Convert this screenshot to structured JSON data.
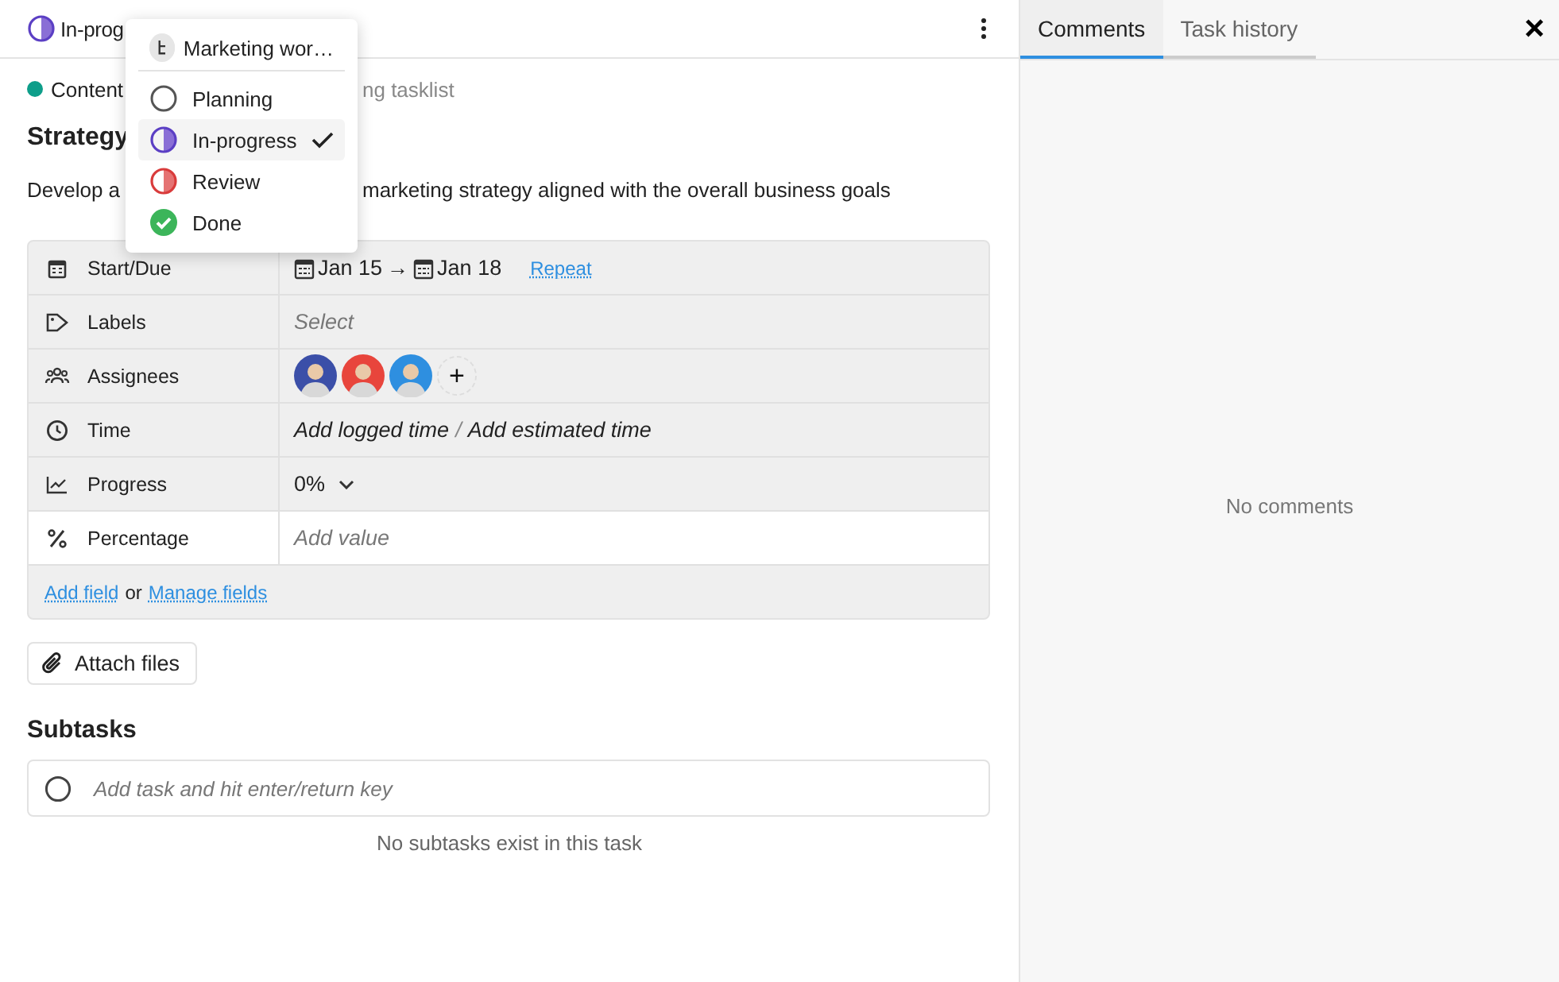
{
  "header": {
    "status": {
      "kind": "inprogress",
      "label": "In-prog"
    }
  },
  "breadcrumb": {
    "color": "#0e9e8a",
    "parts": [
      "Content",
      "ng tasklist"
    ]
  },
  "title": "Strategy",
  "description": [
    "Develop a",
    "marketing strategy aligned with the overall business goals"
  ],
  "status_menu": {
    "workflow": "Marketing wor…",
    "options": [
      {
        "kind": "planning",
        "label": "Planning",
        "selected": false
      },
      {
        "kind": "inprogress",
        "label": "In-progress",
        "selected": true
      },
      {
        "kind": "review",
        "label": "Review",
        "selected": false
      },
      {
        "kind": "done",
        "label": "Done",
        "selected": false
      }
    ]
  },
  "fields": [
    {
      "kind": "dates",
      "highlighted": false,
      "label": "Start/Due",
      "start": "Jan 15",
      "arrow": "→",
      "due": "Jan 18",
      "link": "Repeat"
    },
    {
      "kind": "placeholder",
      "highlighted": false,
      "label": "Labels",
      "placeholder": "Select"
    },
    {
      "kind": "avatars",
      "highlighted": false,
      "label": "Assignees",
      "avatars": [
        {
          "color": "#3b4fa8"
        },
        {
          "color": "#e8453c"
        },
        {
          "color": "#2e8fe0"
        }
      ],
      "add": "+"
    },
    {
      "kind": "time",
      "highlighted": false,
      "label": "Time",
      "logged": "Add logged time",
      "sep": "/",
      "estimated": "Add estimated time"
    },
    {
      "kind": "dropdown",
      "highlighted": false,
      "label": "Progress",
      "value": "0%"
    },
    {
      "kind": "placeholder",
      "highlighted": true,
      "label": "Percentage",
      "placeholder": "Add value"
    }
  ],
  "field_links": {
    "add": "Add field",
    "or": "or",
    "manage": "Manage fields"
  },
  "attach_button": "Attach files",
  "subtasks": {
    "heading": "Subtasks",
    "placeholder": "Add task and hit enter/return key",
    "empty": "No subtasks exist in this task"
  },
  "side_panel": {
    "tabs": [
      {
        "label": "Comments",
        "selected": true
      },
      {
        "label": "Task history",
        "selected": false
      }
    ],
    "close": "×",
    "empty": "No comments"
  }
}
